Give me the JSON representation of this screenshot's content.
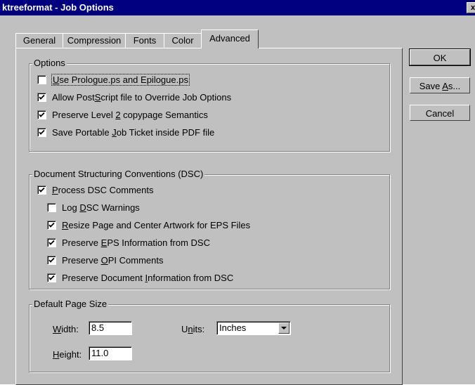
{
  "window": {
    "title": "ktreeformat - Job Options",
    "close_glyph": "x"
  },
  "tabs": [
    {
      "label": "General"
    },
    {
      "label": "Compression"
    },
    {
      "label": "Fonts"
    },
    {
      "label": "Color"
    },
    {
      "label": "Advanced",
      "active": true
    }
  ],
  "options_group": {
    "label": "Options",
    "items": [
      {
        "pre": "",
        "key": "U",
        "post": "se Prologue.ps and Epilogue.ps",
        "checked": false
      },
      {
        "pre": "Allow Post",
        "key": "S",
        "post": "cript file to Override Job Options",
        "checked": true
      },
      {
        "pre": "Preserve Level ",
        "key": "2",
        "post": " copypage Semantics",
        "checked": true
      },
      {
        "pre": "Save Portable ",
        "key": "J",
        "post": "ob Ticket inside PDF file",
        "checked": true
      }
    ]
  },
  "dsc_group": {
    "label": "Document Structuring Conventions (DSC)",
    "process": {
      "pre": "",
      "key": "P",
      "post": "rocess DSC Comments",
      "checked": true
    },
    "items": [
      {
        "pre": "Log ",
        "key": "D",
        "post": "SC Warnings",
        "checked": false
      },
      {
        "pre": "",
        "key": "R",
        "post": "esize Page and Center Artwork for EPS Files",
        "checked": true
      },
      {
        "pre": "Preserve ",
        "key": "E",
        "post": "PS Information from DSC",
        "checked": true
      },
      {
        "pre": "Preserve ",
        "key": "O",
        "post": "PI Comments",
        "checked": true
      },
      {
        "pre": "Preserve Document ",
        "key": "I",
        "post": "nformation from DSC",
        "checked": true
      }
    ]
  },
  "page_size_group": {
    "label": "Default Page Size",
    "width": {
      "key": "W",
      "post": "idth:",
      "value": "8.5"
    },
    "height": {
      "key": "H",
      "post": "eight:",
      "value": "11.0"
    },
    "units": {
      "pre": "U",
      "key": "n",
      "post": "its:",
      "value": "Inches"
    }
  },
  "buttons": {
    "ok": "OK",
    "save_as_pre": "Save ",
    "save_as_key": "A",
    "save_as_post": "s...",
    "cancel": "Cancel"
  }
}
